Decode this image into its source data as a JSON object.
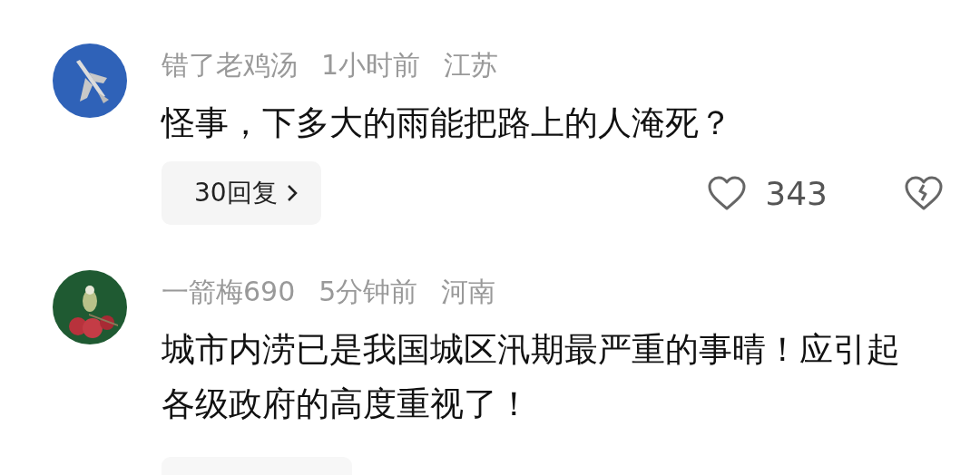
{
  "comments": [
    {
      "user": "错了老鸡汤",
      "time": "1小时前",
      "location": "江苏",
      "text": "怪事，下多大的雨能把路上的人淹死？",
      "footer": {
        "kind": "full",
        "replies": "30回复",
        "likes": "343"
      }
    },
    {
      "user": "一箭梅690",
      "time": "5分钟前",
      "location": "河南",
      "text": "城市内涝已是我国城区汛期最严重的事晴！应引起各级政府的高度重视了！",
      "footer": {
        "kind": "cut"
      }
    }
  ]
}
